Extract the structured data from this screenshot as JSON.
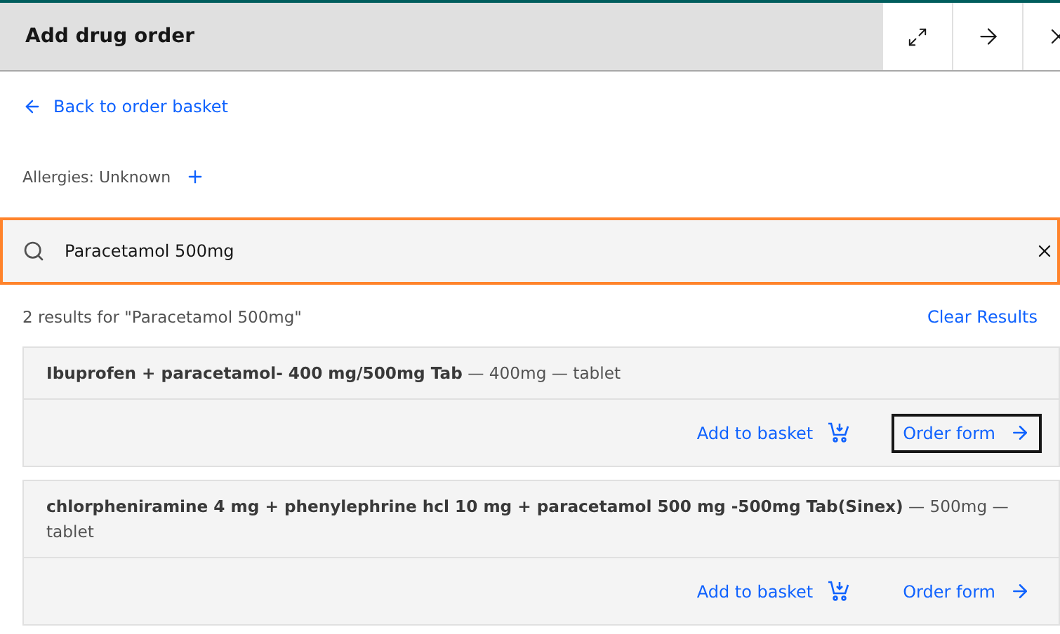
{
  "header": {
    "title": "Add drug order"
  },
  "back_link": "Back to order basket",
  "allergies": "Allergies: Unknown",
  "search": {
    "value": "Paracetamol 500mg",
    "focused": true
  },
  "results_summary": "2 results for \"Paracetamol 500mg\"",
  "clear_results": "Clear Results",
  "results": [
    {
      "description": "**Ibuprofen + paracetamol- 400 mg/500mg Tab** — 400mg — tablet",
      "add_to_basket": "Add to basket",
      "order_form": {
        "label": "Order form",
        "focused": true
      }
    },
    {
      "description": "**chlorpheniramine 4 mg + phenylephrine hcl 10 mg + paracetamol 500 mg -500mg Tab(Sinex)** — 500mg — tablet",
      "add_to_basket": "Add to basket",
      "order_form": {
        "label": "Order form",
        "focused": false
      }
    }
  ]
}
